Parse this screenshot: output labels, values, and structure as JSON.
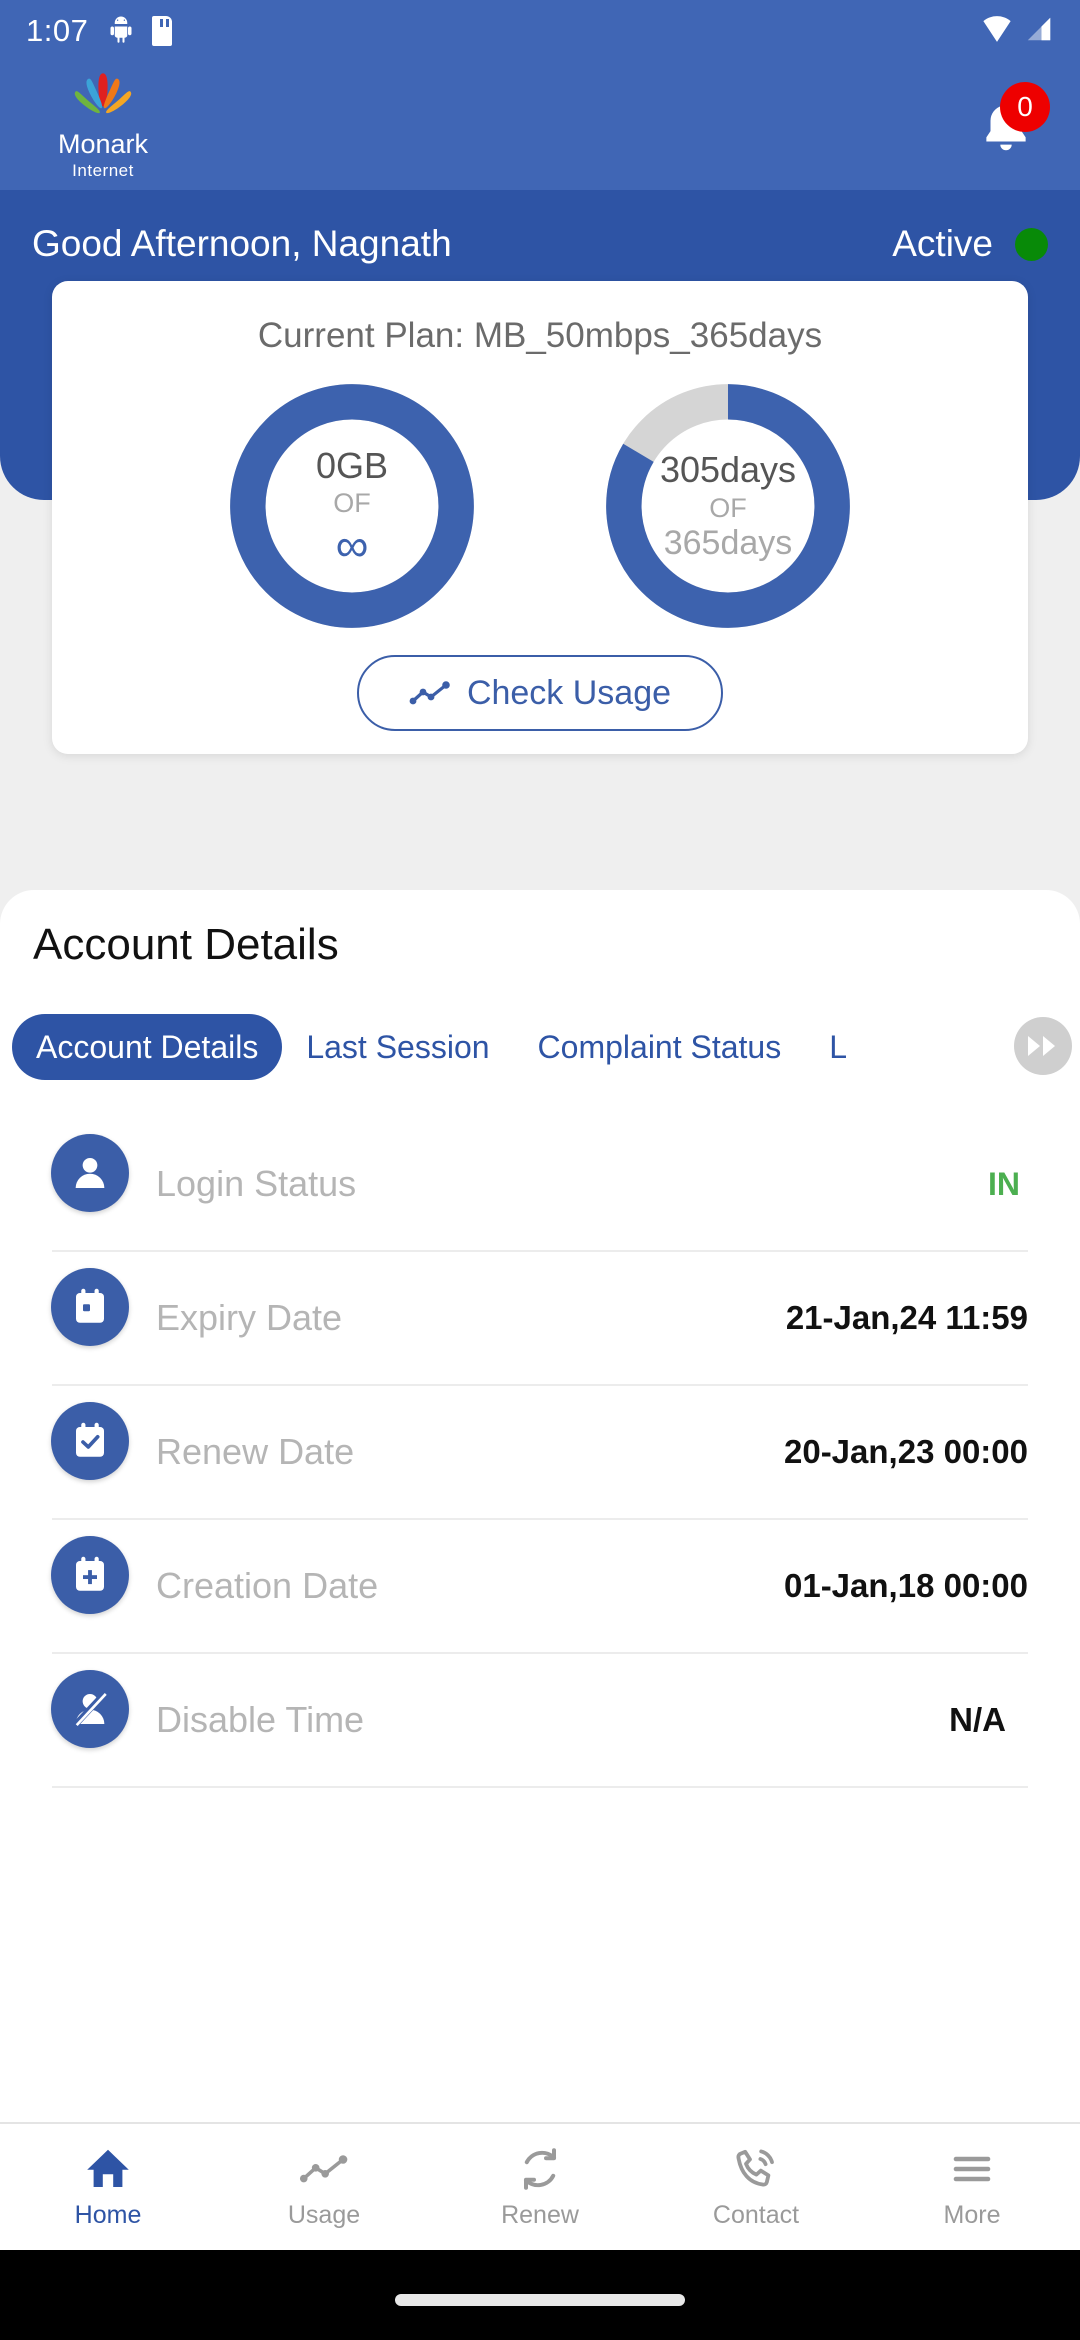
{
  "statusbar": {
    "time": "1:07",
    "icons": [
      "android-icon",
      "sdcard-icon",
      "wifi-icon",
      "signal-icon"
    ]
  },
  "appbar": {
    "logo_name": "Monark",
    "logo_sub": "Internet",
    "notification_icon": "bell-icon",
    "notification_count": "0"
  },
  "greeting": {
    "text": "Good Afternoon, Nagnath",
    "status_label": "Active",
    "status_color": "#088A08"
  },
  "plan_card": {
    "title": "Current Plan: MB_50mbps_365days",
    "gauges": [
      {
        "name": "data-gauge",
        "used": "0GB",
        "of": "OF",
        "total": "∞",
        "percent": 100,
        "fill_color": "#3D62AE",
        "track_color": "#D5D5D5"
      },
      {
        "name": "days-gauge",
        "used": "305days",
        "of": "OF",
        "total": "365days",
        "percent": 83.5,
        "fill_color": "#3D62AE",
        "track_color": "#D5D5D5"
      }
    ],
    "check_usage_label": "Check Usage",
    "check_usage_icon": "line-chart-icon"
  },
  "details": {
    "section_title": "Account Details",
    "tabs": [
      {
        "label": "Account Details",
        "active": true
      },
      {
        "label": "Last Session",
        "active": false
      },
      {
        "label": "Complaint Status",
        "active": false
      },
      {
        "label": "L",
        "active": false
      }
    ],
    "scroll_icon": "fast-forward-icon",
    "rows": [
      {
        "icon": "user-icon",
        "label": "Login Status",
        "value": "IN",
        "value_style": "green"
      },
      {
        "icon": "calendar-icon",
        "label": "Expiry Date",
        "value": "21-Jan,24 11:59",
        "value_style": "normal"
      },
      {
        "icon": "calendar-check-icon",
        "label": "Renew Date",
        "value": "20-Jan,23 00:00",
        "value_style": "normal"
      },
      {
        "icon": "calendar-plus-icon",
        "label": "Creation Date",
        "value": "01-Jan,18 00:00",
        "value_style": "normal"
      },
      {
        "icon": "user-slash-icon",
        "label": "Disable Time",
        "value": "N/A",
        "value_style": "na"
      }
    ]
  },
  "bottom_nav": [
    {
      "label": "Home",
      "icon": "home-icon",
      "active": true
    },
    {
      "label": "Usage",
      "icon": "chart-icon",
      "active": false
    },
    {
      "label": "Renew",
      "icon": "refresh-icon",
      "active": false
    },
    {
      "label": "Contact",
      "icon": "phone-call-icon",
      "active": false
    },
    {
      "label": "More",
      "icon": "hamburger-icon",
      "active": false
    }
  ],
  "theme": {
    "header_blue": "#4066B5",
    "band_blue": "#2E54A5",
    "accent_blue": "#3B5EA8",
    "page_bg": "#efefef",
    "badge_red": "#EE0000"
  }
}
